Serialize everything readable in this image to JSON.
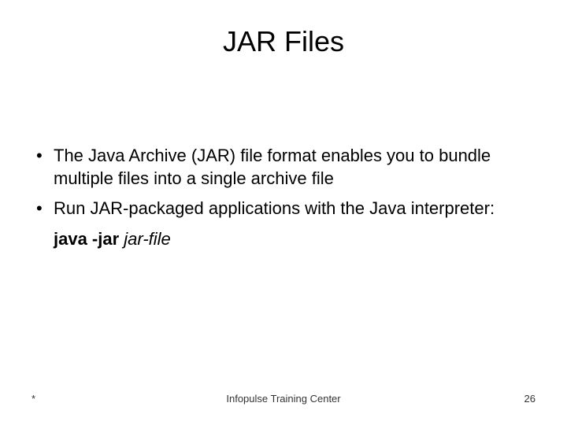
{
  "title": "JAR Files",
  "bullets": [
    "The Java Archive (JAR) file format enables you to bundle multiple files into a single archive file",
    "Run JAR-packaged applications with the Java interpreter:"
  ],
  "command": {
    "bold": "java -jar ",
    "italic": "jar-file"
  },
  "footer": {
    "left": "*",
    "center": "Infopulse Training Center",
    "right": "26"
  }
}
